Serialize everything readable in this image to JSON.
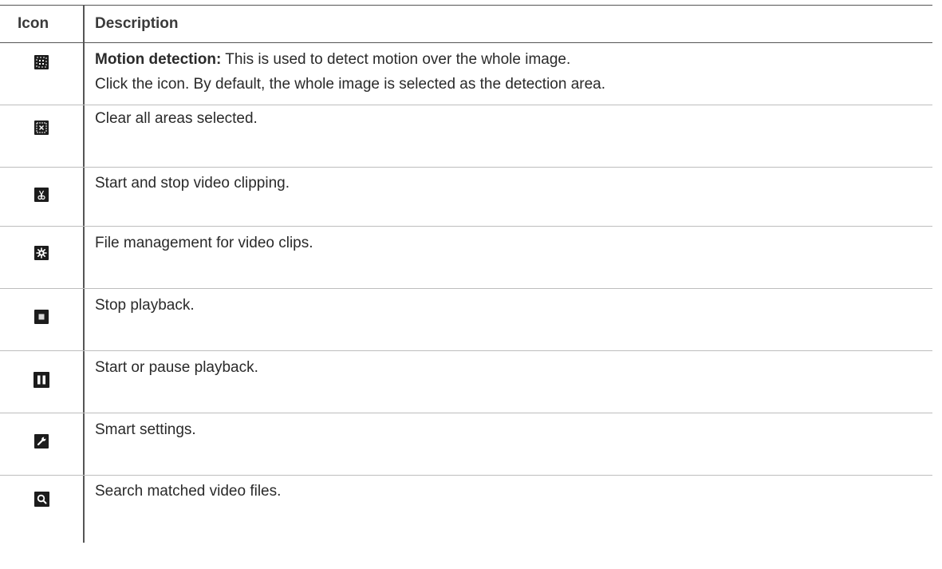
{
  "table": {
    "headers": {
      "icon": "Icon",
      "description": "Description"
    },
    "rows": [
      {
        "icon": "motion-detection-icon",
        "bold_label": "Motion detection:",
        "text": " This is used to detect motion over the whole image.",
        "text2": "Click the icon. By default, the whole image is selected as the detection area."
      },
      {
        "icon": "clear-areas-icon",
        "text": "Clear all areas selected."
      },
      {
        "icon": "scissors-icon",
        "text": "Start and stop video clipping."
      },
      {
        "icon": "gear-icon",
        "text": "File management for video clips."
      },
      {
        "icon": "stop-icon",
        "text": "Stop playback."
      },
      {
        "icon": "pause-icon",
        "text": "Start or pause playback."
      },
      {
        "icon": "wrench-icon",
        "text": "Smart settings."
      },
      {
        "icon": "search-icon",
        "text": "Search matched video files."
      }
    ]
  }
}
